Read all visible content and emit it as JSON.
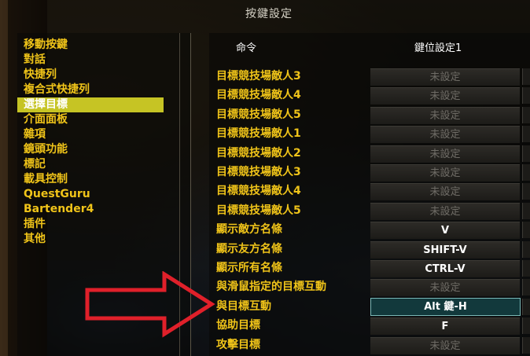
{
  "dialog": {
    "title": "按鍵設定"
  },
  "categories": [
    {
      "label": "移動按鍵",
      "selected": false
    },
    {
      "label": "對話",
      "selected": false
    },
    {
      "label": "快捷列",
      "selected": false
    },
    {
      "label": "複合式快捷列",
      "selected": false
    },
    {
      "label": "選擇目標",
      "selected": true
    },
    {
      "label": "介面面板",
      "selected": false
    },
    {
      "label": "雜項",
      "selected": false
    },
    {
      "label": "鏡頭功能",
      "selected": false
    },
    {
      "label": "標記",
      "selected": false
    },
    {
      "label": "載具控制",
      "selected": false
    },
    {
      "label": "QuestGuru",
      "selected": false
    },
    {
      "label": "Bartender4",
      "selected": false
    },
    {
      "label": "插件",
      "selected": false
    },
    {
      "label": "其他",
      "selected": false
    }
  ],
  "columns": {
    "command": "命令",
    "key1": "鍵位設定1"
  },
  "bindings": [
    {
      "command": "目標競技場敵人3",
      "key": "未設定",
      "unset": true
    },
    {
      "command": "目標競技場敵人4",
      "key": "未設定",
      "unset": true
    },
    {
      "command": "目標競技場敵人5",
      "key": "未設定",
      "unset": true
    },
    {
      "command": "目標競技場敵人1",
      "key": "未設定",
      "unset": true
    },
    {
      "command": "目標競技場敵人2",
      "key": "未設定",
      "unset": true
    },
    {
      "command": "目標競技場敵人3",
      "key": "未設定",
      "unset": true
    },
    {
      "command": "目標競技場敵人4",
      "key": "未設定",
      "unset": true
    },
    {
      "command": "目標競技場敵人5",
      "key": "未設定",
      "unset": true
    },
    {
      "command": "顯示敵方名條",
      "key": "V",
      "unset": false
    },
    {
      "command": "顯示友方名條",
      "key": "SHIFT-V",
      "unset": false
    },
    {
      "command": "顯示所有名條",
      "key": "CTRL-V",
      "unset": false
    },
    {
      "command": "與滑鼠指定的目標互動",
      "key": "未設定",
      "unset": true
    },
    {
      "command": "與目標互動",
      "key": "Alt 鍵-H",
      "unset": false,
      "active": true
    },
    {
      "command": "協助目標",
      "key": "F",
      "unset": false
    },
    {
      "command": "攻擊目標",
      "key": "未設定",
      "unset": true
    }
  ],
  "colors": {
    "accent": "#f0c419",
    "selected_bg": "#c6c424",
    "annotation": "#e0202a"
  }
}
